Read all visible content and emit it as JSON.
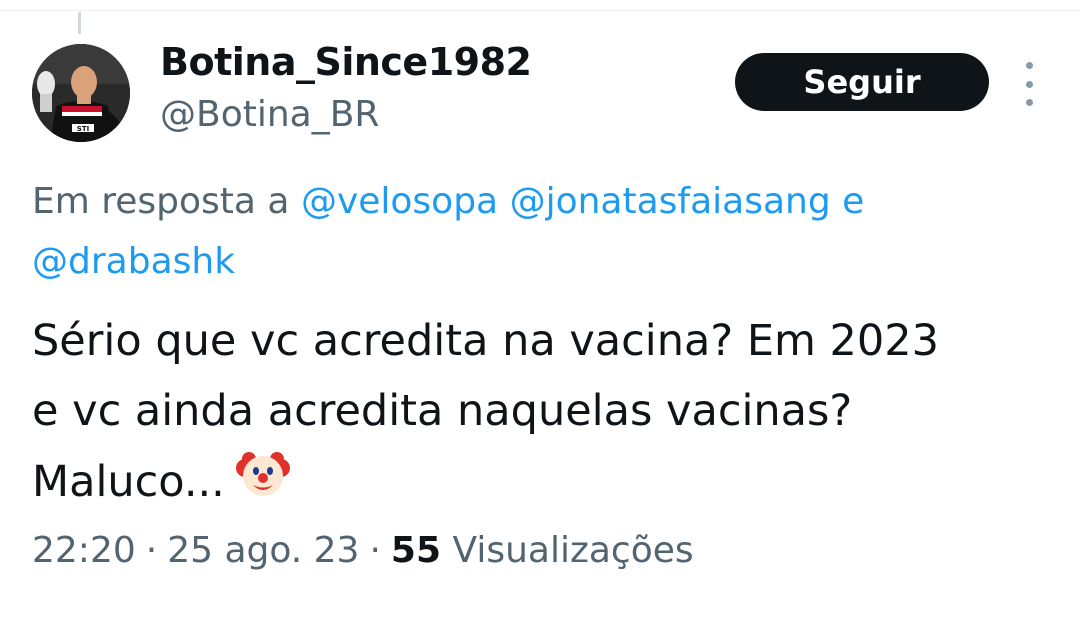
{
  "user": {
    "display_name": "Botina_Since1982",
    "handle": "@Botina_BR",
    "follow_label": "Seguir",
    "avatar_icon": "avatar-photo",
    "more_icon": "more-options-icon"
  },
  "reply": {
    "prefix": "Em resposta a",
    "mention_1": "@velosopa",
    "mention_2": "@jonatasfaiasang",
    "conjunction": "e",
    "mention_3": "@drabashk"
  },
  "tweet": {
    "line_1": "Sério que vc acredita na vacina? Em 2023",
    "line_2": "e vc ainda acredita naquelas vacinas?",
    "line_3": "Maluco...",
    "emoji": "clown-face"
  },
  "meta": {
    "time": "22:20",
    "date": "25 ago. 23",
    "separator": "·",
    "views_count": "55",
    "views_label": "Visualizações"
  },
  "colors": {
    "text": "#0f1419",
    "secondary": "#536471",
    "link": "#1d9bf0",
    "button_bg": "#0f1419"
  }
}
